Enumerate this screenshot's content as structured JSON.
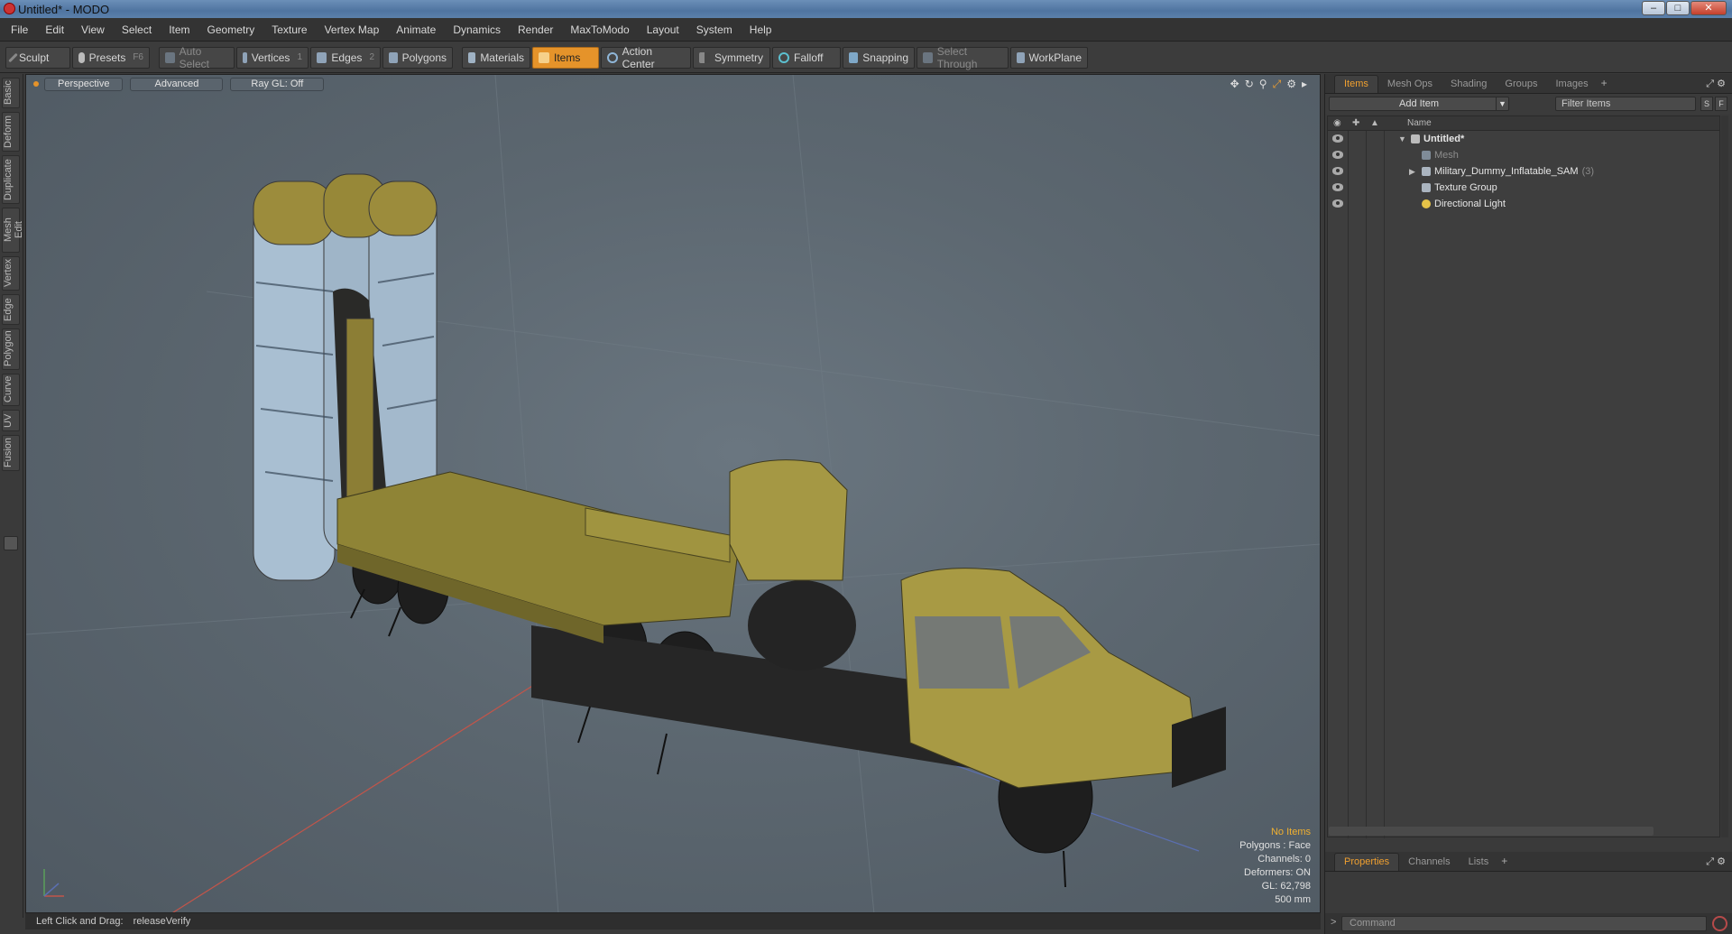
{
  "window": {
    "title": "Untitled* - MODO"
  },
  "menu": [
    "File",
    "Edit",
    "View",
    "Select",
    "Item",
    "Geometry",
    "Texture",
    "Vertex Map",
    "Animate",
    "Dynamics",
    "Render",
    "MaxToModo",
    "Layout",
    "System",
    "Help"
  ],
  "toolbar": {
    "sculpt": "Sculpt",
    "presets": "Presets",
    "presets_key": "F6",
    "auto_select": "Auto Select",
    "vertices": "Vertices",
    "vertices_key": "1",
    "edges": "Edges",
    "edges_key": "2",
    "polygons": "Polygons",
    "materials": "Materials",
    "items": "Items",
    "action_center": "Action Center",
    "symmetry": "Symmetry",
    "falloff": "Falloff",
    "snapping": "Snapping",
    "select_through": "Select Through",
    "workplane": "WorkPlane"
  },
  "left_tabs": [
    "Basic",
    "Deform",
    "Duplicate",
    "Mesh Edit",
    "Vertex",
    "Edge",
    "Polygon",
    "Curve",
    "UV",
    "Fusion"
  ],
  "viewport": {
    "view": "Perspective",
    "shading": "Advanced",
    "raygl": "Ray GL: Off",
    "stats": {
      "selection": "No Items",
      "polygons": "Polygons : Face",
      "channels": "Channels: 0",
      "deformers": "Deformers: ON",
      "gl": "GL: 62,798",
      "grid": "500 mm"
    }
  },
  "status": {
    "label": "Left Click and Drag:",
    "value": "releaseVerify"
  },
  "items_panel": {
    "tabs": [
      "Items",
      "Mesh Ops",
      "Shading",
      "Groups",
      "Images"
    ],
    "add_item": "Add Item",
    "filter_placeholder": "Filter Items",
    "btn_s": "S",
    "btn_f": "F",
    "col_name": "Name",
    "rows": [
      {
        "label": "Untitled*"
      },
      {
        "label": "Mesh"
      },
      {
        "label": "Military_Dummy_Inflatable_SAM",
        "count": "(3)"
      },
      {
        "label": "Texture Group"
      },
      {
        "label": "Directional Light"
      }
    ]
  },
  "props_panel": {
    "tabs": [
      "Properties",
      "Channels",
      "Lists"
    ]
  },
  "command": {
    "placeholder": "Command"
  }
}
